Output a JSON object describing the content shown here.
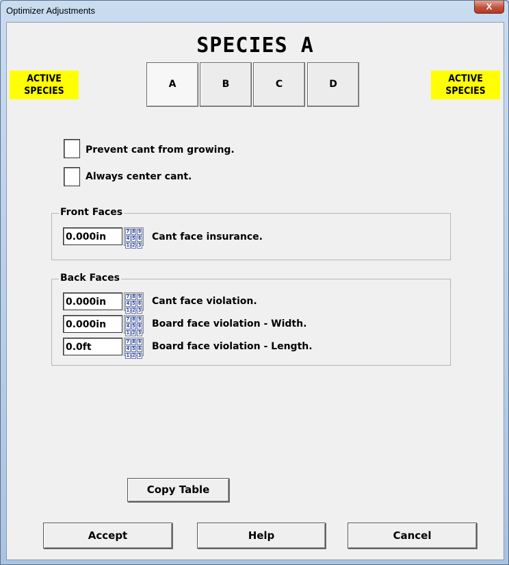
{
  "window": {
    "title": "Optimizer Adjustments",
    "close_label": "X"
  },
  "header": {
    "species_title": "SPECIES A"
  },
  "badges": {
    "left": "ACTIVE\nSPECIES",
    "right": "ACTIVE\nSPECIES"
  },
  "tabs": [
    {
      "label": "A",
      "selected": true
    },
    {
      "label": "B",
      "selected": false
    },
    {
      "label": "C",
      "selected": false
    },
    {
      "label": "D",
      "selected": false
    }
  ],
  "options": [
    {
      "label": "Prevent cant from growing.",
      "checked": false
    },
    {
      "label": "Always center cant.",
      "checked": false
    }
  ],
  "front_faces": {
    "title": "Front Faces",
    "fields": [
      {
        "value": "0.000in",
        "label": "Cant face insurance."
      }
    ]
  },
  "back_faces": {
    "title": "Back Faces",
    "fields": [
      {
        "value": "0.000in",
        "label": "Cant face violation."
      },
      {
        "value": "0.000in",
        "label": "Board face violation - Width."
      },
      {
        "value": "0.0ft",
        "label": "Board face violation - Length."
      }
    ]
  },
  "keypad_digits": [
    "7",
    "8",
    "9",
    "4",
    "5",
    "6",
    "1",
    "2",
    "3"
  ],
  "buttons": {
    "copy_table": "Copy Table",
    "accept": "Accept",
    "help": "Help",
    "cancel": "Cancel"
  }
}
